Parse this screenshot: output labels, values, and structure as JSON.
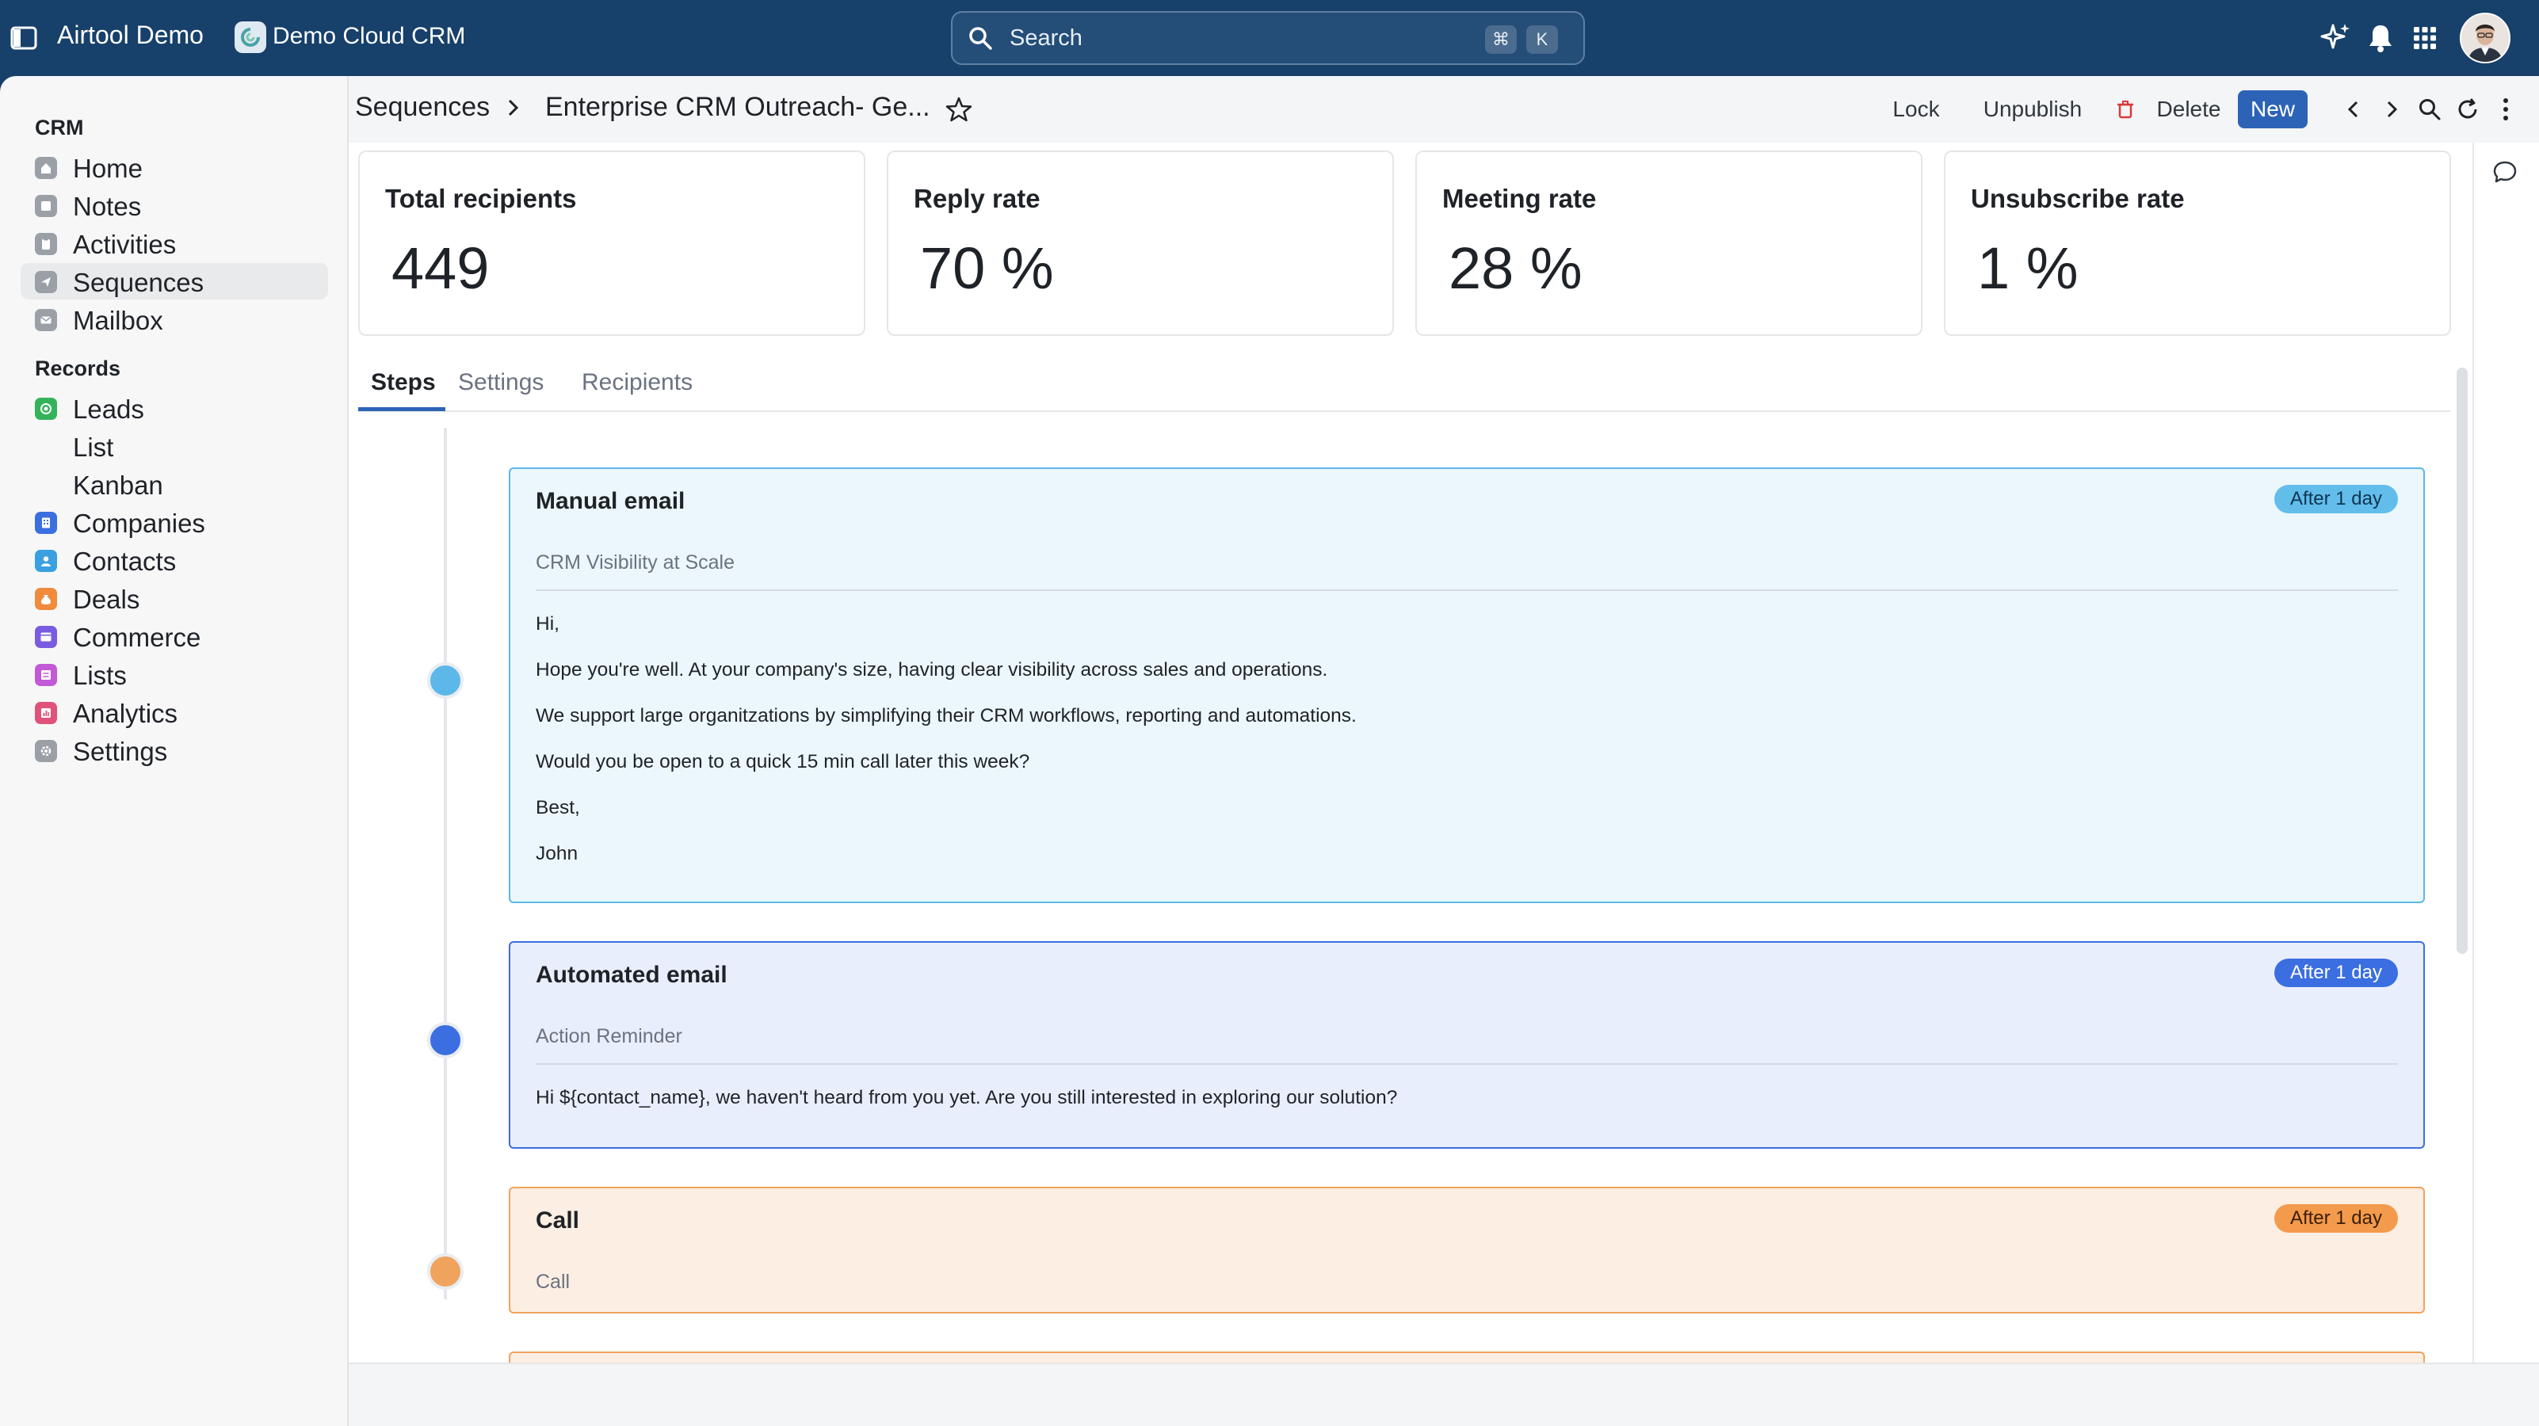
{
  "app": {
    "title": "Airtool Demo",
    "workspace": "Demo Cloud CRM"
  },
  "search": {
    "placeholder": "Search",
    "shortcut_keys": [
      "⌘",
      "K"
    ]
  },
  "sidebar": {
    "sections": [
      {
        "label": "CRM",
        "items": [
          {
            "label": "Home",
            "icon": "home-icon",
            "color": "#9aa0a6"
          },
          {
            "label": "Notes",
            "icon": "note-icon",
            "color": "#9aa0a6"
          },
          {
            "label": "Activities",
            "icon": "clipboard-icon",
            "color": "#9aa0a6"
          },
          {
            "label": "Sequences",
            "icon": "send-icon",
            "color": "#9aa0a6",
            "active": true
          },
          {
            "label": "Mailbox",
            "icon": "mail-icon",
            "color": "#9aa0a6"
          }
        ]
      },
      {
        "label": "Records",
        "items": [
          {
            "label": "Leads",
            "icon": "target-icon",
            "color": "#34b45a"
          },
          {
            "label": "List",
            "sub": true
          },
          {
            "label": "Kanban",
            "sub": true
          },
          {
            "label": "Companies",
            "icon": "building-icon",
            "color": "#3b6fe0"
          },
          {
            "label": "Contacts",
            "icon": "person-icon",
            "color": "#3aa0e0"
          },
          {
            "label": "Deals",
            "icon": "money-bag-icon",
            "color": "#f08a3c"
          },
          {
            "label": "Commerce",
            "icon": "window-icon",
            "color": "#7a5ce0"
          },
          {
            "label": "Lists",
            "icon": "list-icon",
            "color": "#c25ad6"
          },
          {
            "label": "Analytics",
            "icon": "chart-icon",
            "color": "#e0527a"
          },
          {
            "label": "Settings",
            "icon": "gear-icon",
            "color": "#9aa0a6"
          }
        ]
      }
    ]
  },
  "header": {
    "breadcrumb_root": "Sequences",
    "breadcrumb_current": "Enterprise CRM Outreach- Ge...",
    "lock_label": "Lock",
    "unpublish_label": "Unpublish",
    "delete_label": "Delete",
    "new_label": "New"
  },
  "stats": [
    {
      "label": "Total recipients",
      "value": "449"
    },
    {
      "label": "Reply rate",
      "value": "70 %"
    },
    {
      "label": "Meeting rate",
      "value": "28 %"
    },
    {
      "label": "Unsubscribe rate",
      "value": "1 %"
    }
  ],
  "tabs": [
    "Steps",
    "Settings",
    "Recipients"
  ],
  "steps": [
    {
      "title": "Manual email",
      "badge": "After 1 day",
      "subject": "CRM Visibility at Scale",
      "body": [
        "Hi,",
        "Hope you're well. At your company's size, having clear visibility across sales and operations.",
        "We support large organitzations by simplifying their CRM workflows, reporting and automations.",
        "Would you be open to a quick 15 min call later this week?",
        "Best,",
        "John"
      ],
      "color": "#5bb8e8",
      "bg": "#ebf7fc",
      "badge_bg": "#62bdeb"
    },
    {
      "title": "Automated email",
      "badge": "After 1 day",
      "subject": "Action Reminder",
      "body": [
        "Hi ${contact_name}, we haven't heard from you yet. Are you still interested in exploring our solution?"
      ],
      "color": "#3b6ee0",
      "bg": "#e9eefc",
      "badge_bg": "#3b6ee0"
    },
    {
      "title": "Call",
      "badge": "After 1 day",
      "subject": "Call",
      "body": [],
      "color": "#f0a35c",
      "bg": "#fdeee3",
      "badge_bg": "#f39a4c"
    }
  ]
}
